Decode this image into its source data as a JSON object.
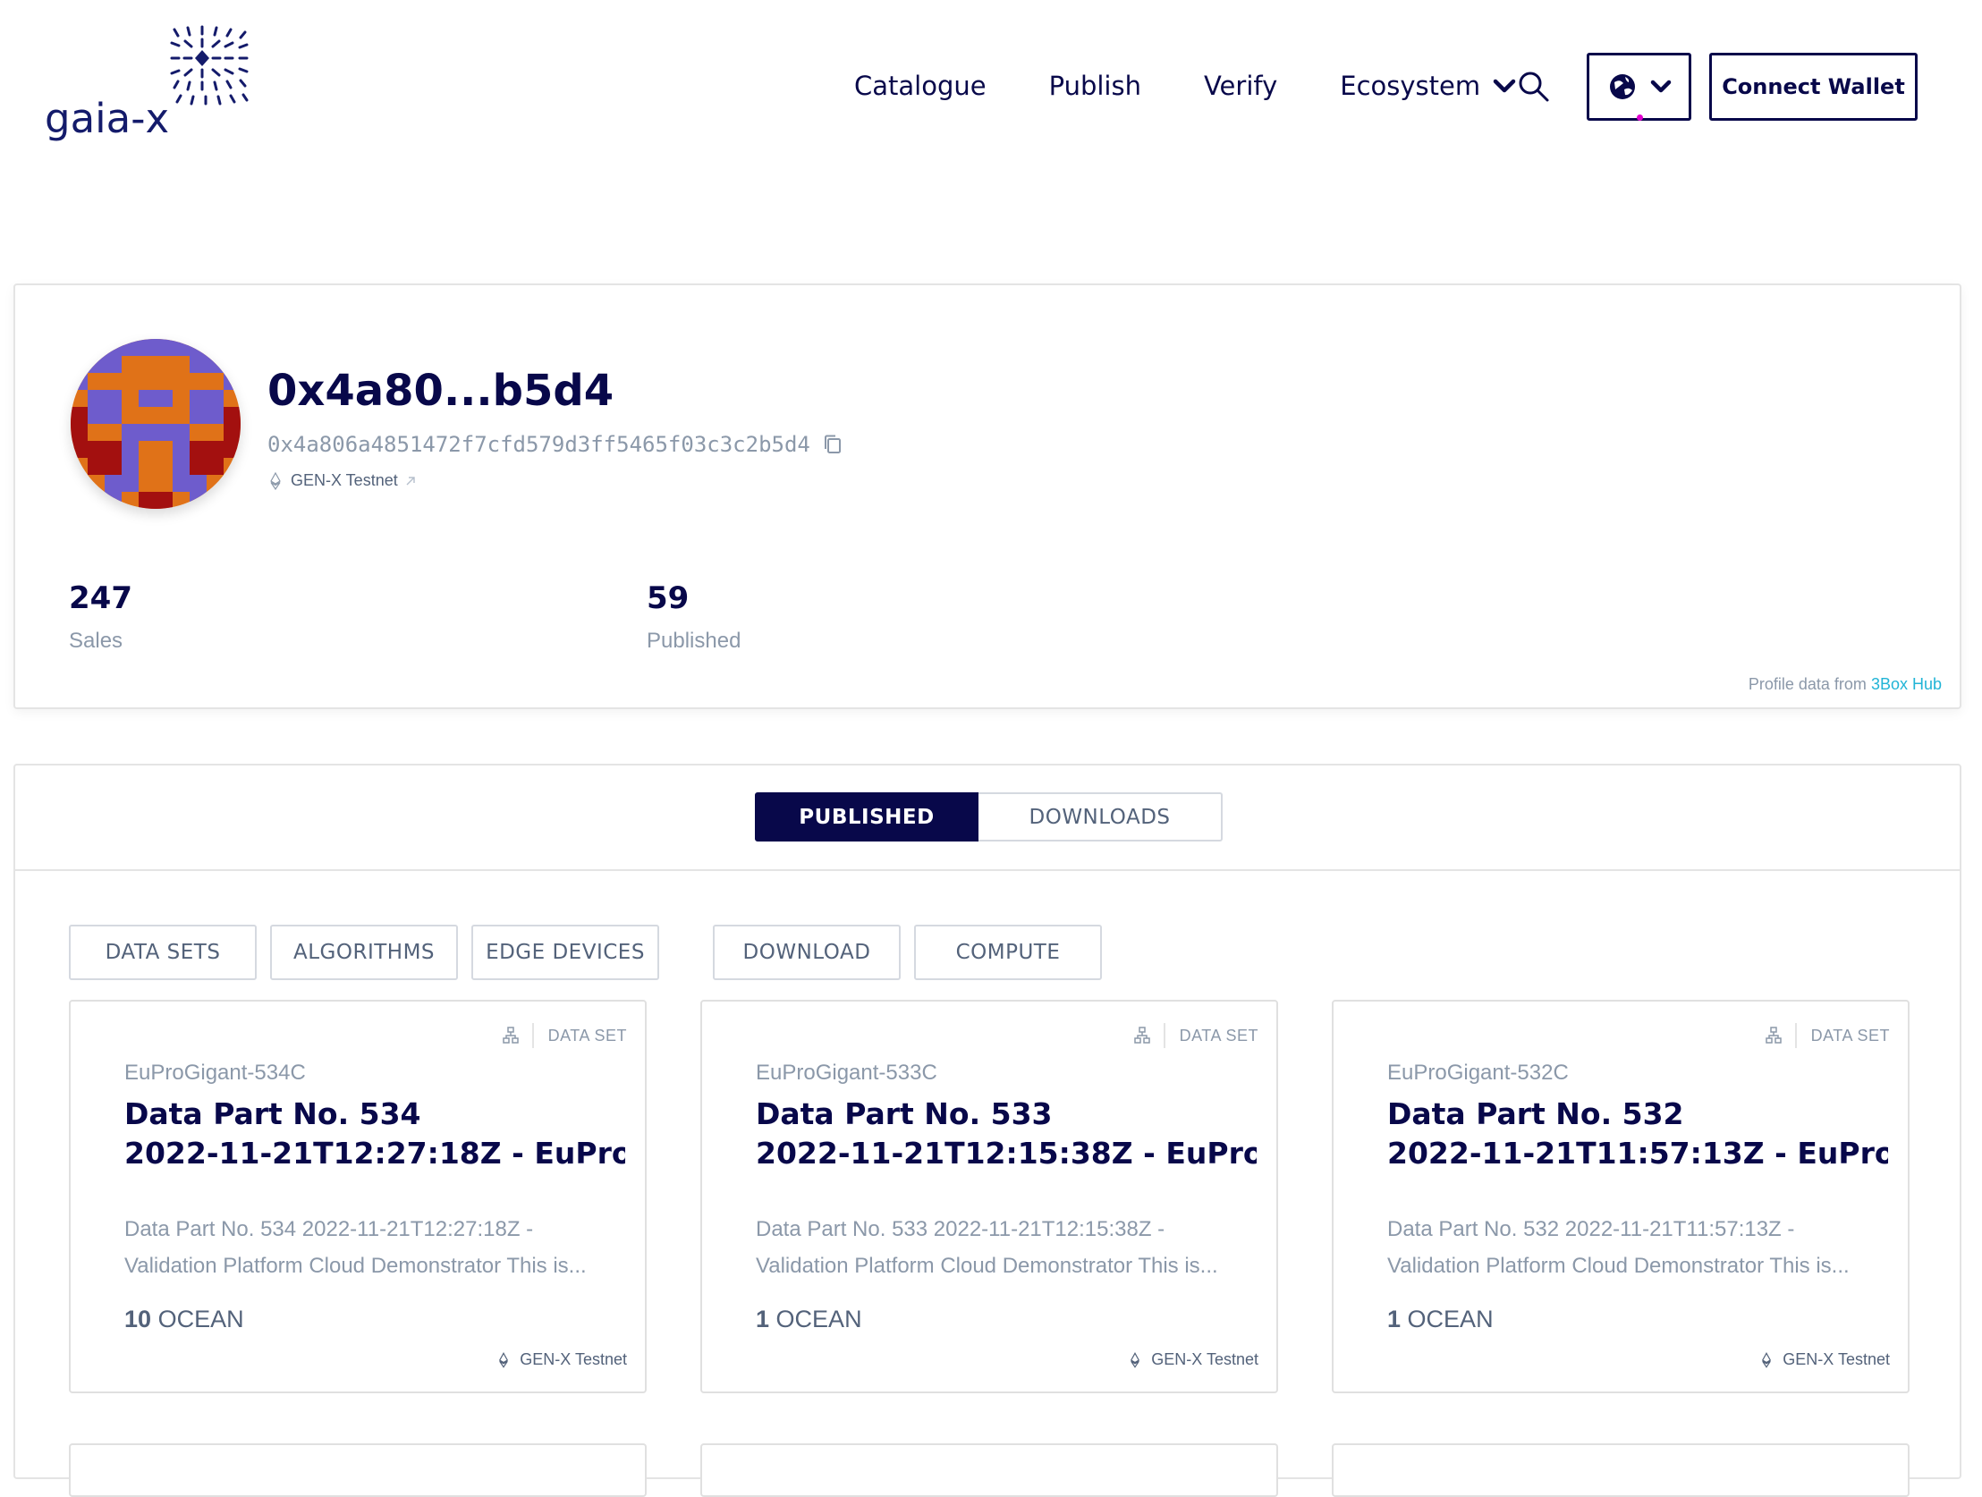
{
  "header": {
    "logo_text": "gaia-x",
    "nav": {
      "catalogue": "Catalogue",
      "publish": "Publish",
      "verify": "Verify",
      "ecosystem": "Ecosystem"
    },
    "connect_wallet": "Connect Wallet"
  },
  "profile": {
    "name": "0x4a80...b5d4",
    "address": "0x4a806a4851472f7cfd579d3ff5465f03c3c2b5d4",
    "network": "GEN-X Testnet",
    "stats": {
      "sales_value": "247",
      "sales_label": "Sales",
      "published_value": "59",
      "published_label": "Published"
    },
    "source_prefix": "Profile data from",
    "source_link": "3Box Hub"
  },
  "history": {
    "tabs": {
      "published": "PUBLISHED",
      "downloads": "DOWNLOADS"
    },
    "filters": {
      "data_sets": "DATA SETS",
      "algorithms": "ALGORITHMS",
      "edge_devices": "EDGE DEVICES",
      "download": "DOWNLOAD",
      "compute": "COMPUTE"
    },
    "assets": [
      {
        "type": "DATA SET",
        "publisher": "EuProGigant-534C",
        "title_line1": "Data Part No. 534",
        "title_line2": "2022-11-21T12:27:18Z - EuPro...",
        "desc_line1": "Data Part No. 534 2022-11-21T12:27:18Z -",
        "desc_line2": "Validation Platform Cloud Demonstrator This is...",
        "price": "10",
        "currency": "OCEAN",
        "network": "GEN-X Testnet"
      },
      {
        "type": "DATA SET",
        "publisher": "EuProGigant-533C",
        "title_line1": "Data Part No. 533",
        "title_line2": "2022-11-21T12:15:38Z - EuPro...",
        "desc_line1": "Data Part No. 533 2022-11-21T12:15:38Z -",
        "desc_line2": "Validation Platform Cloud Demonstrator This is...",
        "price": "1",
        "currency": "OCEAN",
        "network": "GEN-X Testnet"
      },
      {
        "type": "DATA SET",
        "publisher": "EuProGigant-532C",
        "title_line1": "Data Part No. 532",
        "title_line2": "2022-11-21T11:57:13Z - EuPro...",
        "desc_line1": "Data Part No. 532 2022-11-21T11:57:13Z -",
        "desc_line2": "Validation Platform Cloud Demonstrator This is...",
        "price": "1",
        "currency": "OCEAN",
        "network": "GEN-X Testnet"
      }
    ]
  },
  "colors": {
    "primary": "#08084a",
    "muted": "#8b98a9",
    "link": "#21b4d6",
    "accent_dot": "#e000cf"
  }
}
